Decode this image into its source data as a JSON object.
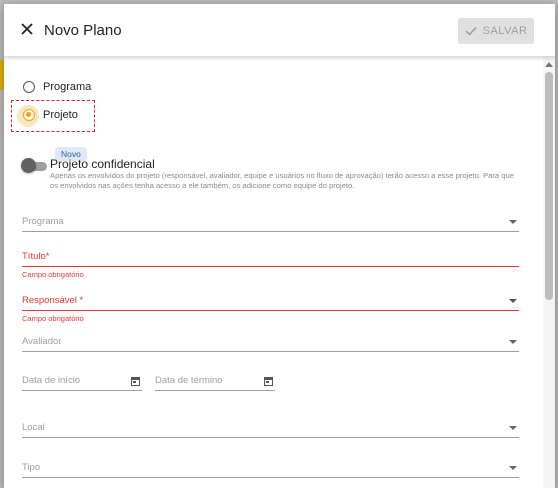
{
  "dialog": {
    "title": "Novo Plano",
    "save_label": "SALVAR"
  },
  "plan_type": {
    "options": [
      {
        "label": "Programa",
        "selected": false
      },
      {
        "label": "Projeto",
        "selected": true
      }
    ]
  },
  "confidential": {
    "badge": "Novo",
    "title": "Projeto confidencial",
    "description": "Apenas os envolvidos do projeto (responsável, avaliador, equipe e usuários no fluxo de aprovação) terão acesso a esse projeto. Para que os envolvidos nas ações tenha acesso a ele também, os adicione como equipe do projeto.",
    "enabled": false
  },
  "fields": {
    "programa": "Programa",
    "titulo": "Título*",
    "titulo_help": "Campo obrigatório",
    "responsavel": "Responsável *",
    "responsavel_help": "Campo obrigatório",
    "avaliador": "Avaliador",
    "data_inicio": "Data de início",
    "data_termino": "Data de término",
    "local": "Local",
    "tipo": "Tipo"
  },
  "colors": {
    "accent": "#f0a000",
    "error": "#e53935",
    "badge_bg": "#dfe9f5",
    "badge_text": "#2b62a8"
  }
}
